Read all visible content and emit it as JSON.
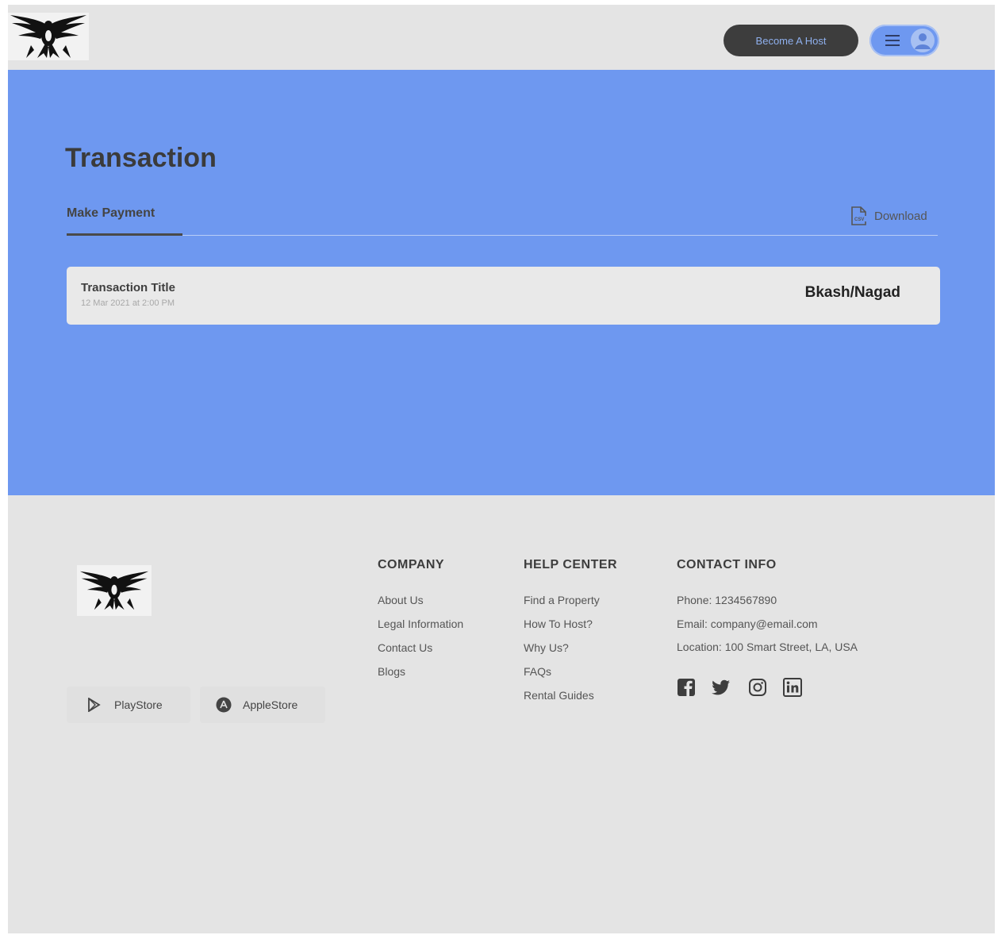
{
  "header": {
    "become_host_label": "Become A Host"
  },
  "page": {
    "title": "Transaction",
    "tab_label": "Make Payment",
    "download_label": "Download"
  },
  "transaction": {
    "title": "Transaction Title",
    "date": "12 Mar 2021 at 2:00 PM",
    "method": "Bkash/Nagad"
  },
  "footer": {
    "stores": {
      "play": "PlayStore",
      "apple": "AppleStore"
    },
    "company": {
      "heading": "COMPANY",
      "links": [
        "About Us",
        "Legal Information",
        "Contact Us",
        "Blogs"
      ]
    },
    "help": {
      "heading": "HELP CENTER",
      "links": [
        "Find a Property",
        "How To Host?",
        "Why Us?",
        "FAQs",
        "Rental Guides"
      ]
    },
    "contact": {
      "heading": "CONTACT INFO",
      "phone": "Phone: 1234567890",
      "email": "Email: company@email.com",
      "location": "Location: 100 Smart Street, LA, USA"
    },
    "social_icons": [
      "facebook-icon",
      "twitter-icon",
      "instagram-icon",
      "linkedin-icon"
    ]
  },
  "colors": {
    "hero_blue": "#6e98f0",
    "page_gray": "#e4e4e4",
    "dark_button": "#3d3d3d"
  }
}
